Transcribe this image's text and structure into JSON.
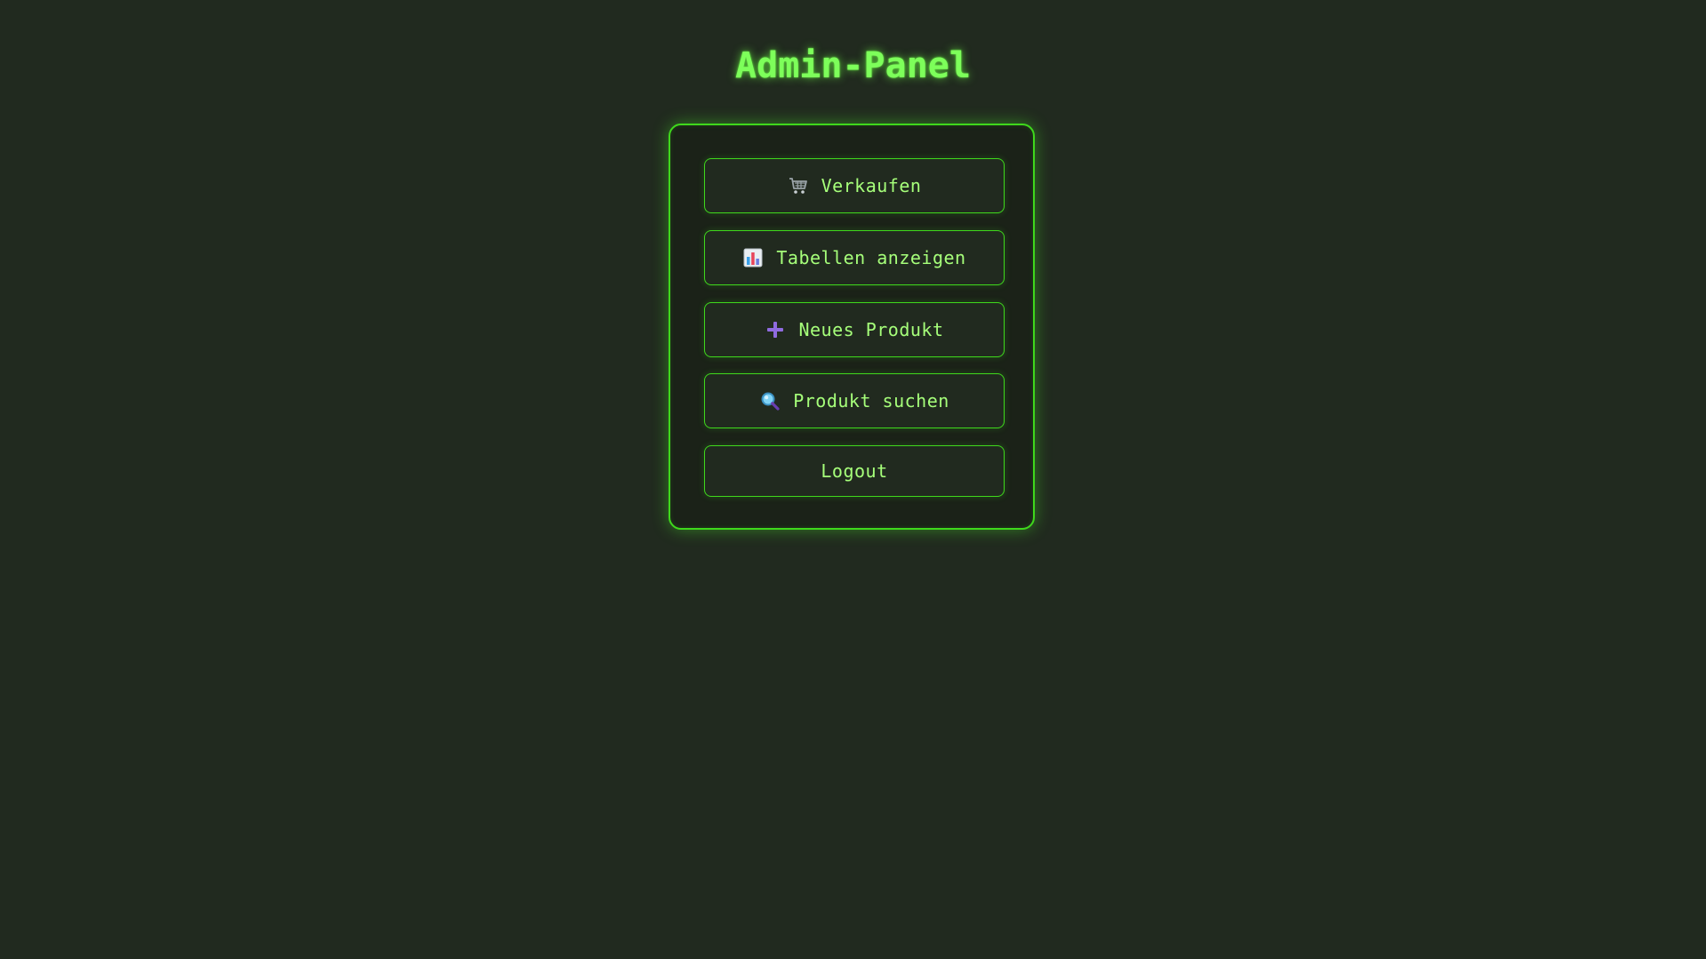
{
  "page": {
    "title": "Admin-Panel"
  },
  "menu": {
    "items": [
      {
        "label": "Verkaufen",
        "icon": "shopping-cart-icon"
      },
      {
        "label": "Tabellen anzeigen",
        "icon": "bar-chart-icon"
      },
      {
        "label": "Neues Produkt",
        "icon": "plus-icon"
      },
      {
        "label": "Produkt suchen",
        "icon": "magnifier-icon"
      },
      {
        "label": "Logout",
        "icon": ""
      }
    ]
  },
  "colors": {
    "background": "#212a1f",
    "accent": "#3fd81c",
    "title": "#7dff5a",
    "button_text": "#a6ff7a"
  }
}
